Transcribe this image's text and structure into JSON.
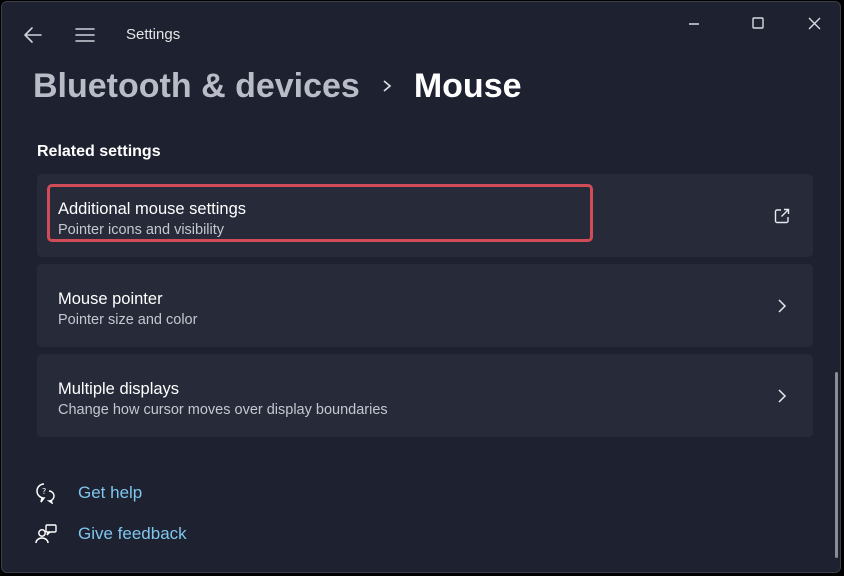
{
  "window": {
    "title": "Settings",
    "controls": {
      "minimize_icon": "minimize-icon",
      "maximize_icon": "maximize-icon",
      "close_icon": "close-icon"
    }
  },
  "nav": {
    "back_icon": "back-arrow-icon",
    "menu_icon": "hamburger-menu-icon"
  },
  "breadcrumb": {
    "parent": "Bluetooth & devices",
    "current": "Mouse"
  },
  "related": {
    "heading": "Related settings",
    "items": [
      {
        "title": "Additional mouse settings",
        "subtitle": "Pointer icons and visibility",
        "trailing_icon": "open-external-icon",
        "highlighted": true
      },
      {
        "title": "Mouse pointer",
        "subtitle": "Pointer size and color",
        "trailing_icon": "chevron-right-icon"
      },
      {
        "title": "Multiple displays",
        "subtitle": "Change how cursor moves over display boundaries",
        "trailing_icon": "chevron-right-icon"
      }
    ]
  },
  "support": {
    "get_help": "Get help",
    "give_feedback": "Give feedback"
  },
  "colors": {
    "background": "#1d2130",
    "card": "#272b39",
    "link": "#7fc6ee",
    "highlight_border": "#d24c57"
  }
}
